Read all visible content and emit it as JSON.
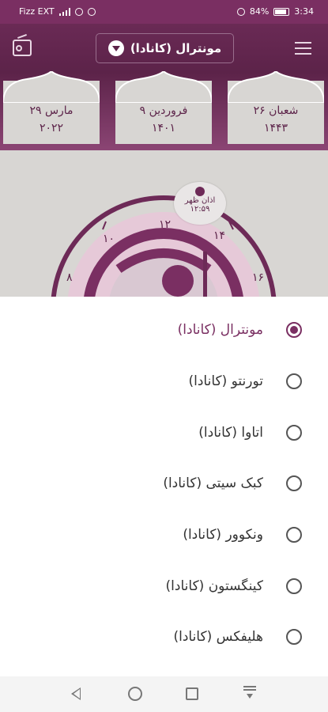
{
  "status_bar": {
    "carrier": "Fizz EXT",
    "battery": "84%",
    "time": "3:34"
  },
  "header": {
    "city_button_label": "مونترال (کانادا)"
  },
  "dates": {
    "hijri": {
      "line1": "۲۶ شعبان",
      "line2": "۱۴۴۳"
    },
    "shamsi": {
      "line1": "۹ فروردین",
      "line2": "۱۴۰۱"
    },
    "gregorian": {
      "line1": "۲۹ مارس",
      "line2": "۲۰۲۲"
    }
  },
  "clock": {
    "azan_label": "اذان ظهر",
    "azan_time": "۱۲:۵۹",
    "hour_labels": [
      "۸",
      "۱۰",
      "۱۲",
      "۱۴",
      "۱۶"
    ]
  },
  "city_options": {
    "items": [
      {
        "label": "مونترال (کانادا)",
        "selected": true
      },
      {
        "label": "تورنتو (کانادا)",
        "selected": false
      },
      {
        "label": "اتاوا (کانادا)",
        "selected": false
      },
      {
        "label": "کبک سیتی (کانادا)",
        "selected": false
      },
      {
        "label": "ونکوور (کانادا)",
        "selected": false
      },
      {
        "label": "کینگستون (کانادا)",
        "selected": false
      },
      {
        "label": "هلیفکس (کانادا)",
        "selected": false
      }
    ]
  },
  "colors": {
    "primary": "#7a2f62",
    "header_dark": "#5c2349",
    "background_pattern": "#d8d6d3"
  }
}
